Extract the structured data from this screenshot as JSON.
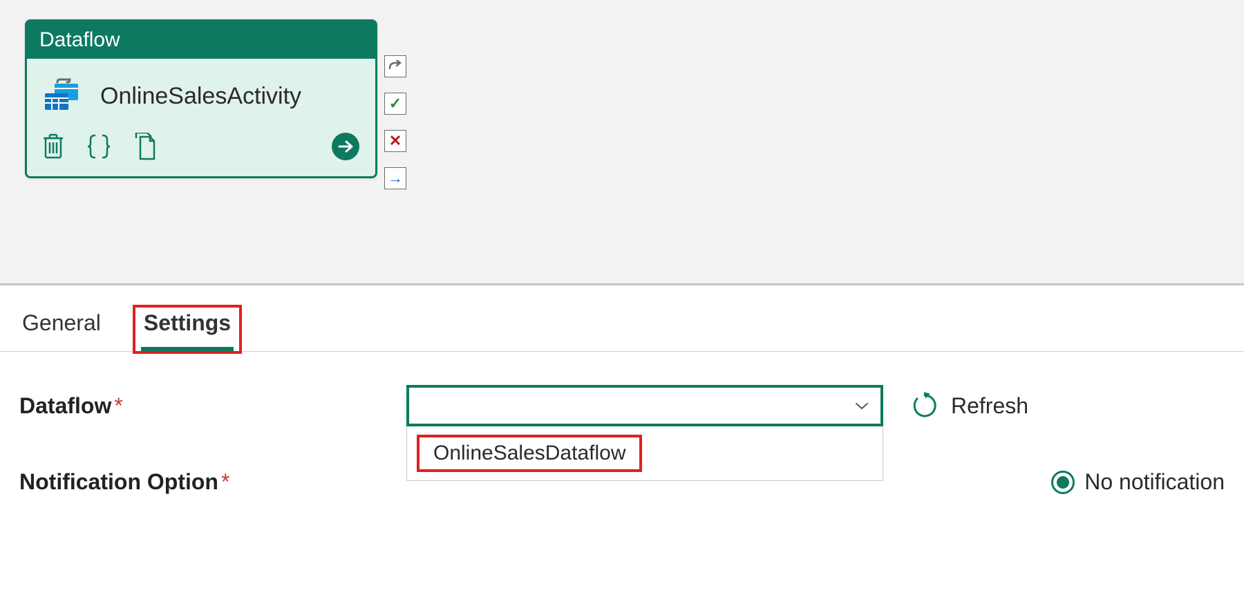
{
  "activity": {
    "type": "Dataflow",
    "name": "OnlineSalesActivity"
  },
  "tabs": {
    "general": "General",
    "settings": "Settings"
  },
  "settings": {
    "dataflow_label": "Dataflow",
    "dataflow_value": "",
    "dataflow_options": [
      "OnlineSalesDataflow"
    ],
    "refresh_label": "Refresh",
    "notification_label": "Notification Option",
    "notification_value": "No notification"
  }
}
